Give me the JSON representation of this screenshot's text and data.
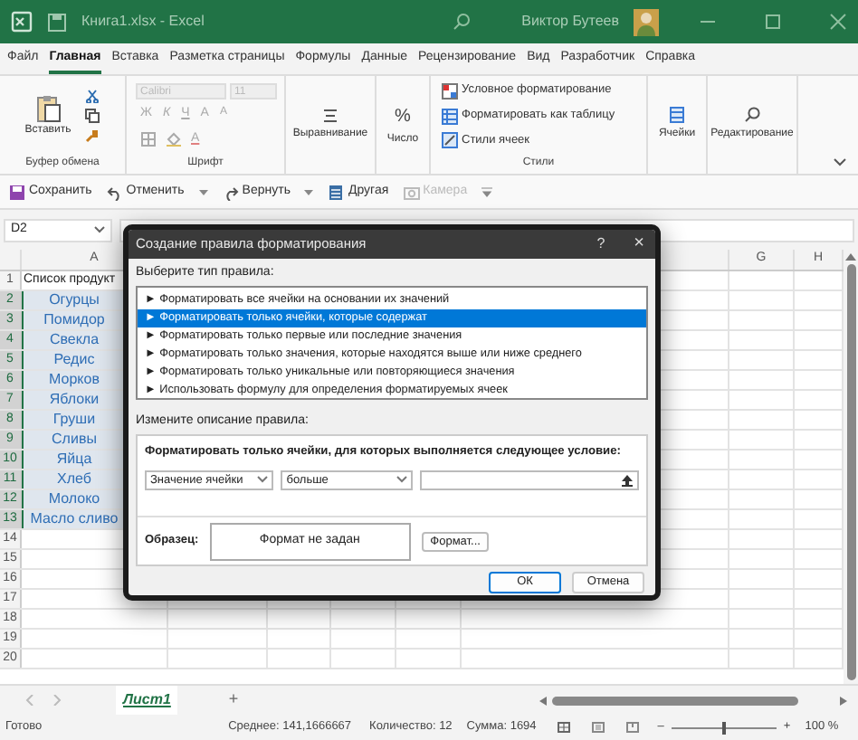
{
  "window": {
    "title": "Книга1.xlsx - Excel",
    "user": "Виктор Бутеев"
  },
  "ribbon_tabs": [
    {
      "label": "Файл",
      "selected": false
    },
    {
      "label": "Главная",
      "selected": true
    },
    {
      "label": "Вставка",
      "selected": false
    },
    {
      "label": "Разметка страницы",
      "selected": false
    },
    {
      "label": "Формулы",
      "selected": false
    },
    {
      "label": "Данные",
      "selected": false
    },
    {
      "label": "Рецензирование",
      "selected": false
    },
    {
      "label": "Вид",
      "selected": false
    },
    {
      "label": "Разработчик",
      "selected": false
    },
    {
      "label": "Справка",
      "selected": false
    }
  ],
  "ribbon": {
    "clipboard": {
      "paste": "Вставить",
      "label": "Буфер обмена"
    },
    "font": {
      "name": "Calibri",
      "size": "11",
      "bold": "Ж",
      "italic": "К",
      "underline": "Ч",
      "grow": "A",
      "shrink": "A",
      "font_color_button": "A",
      "label": "Шрифт"
    },
    "alignment": "Выравнивание",
    "number": {
      "symbol": "%",
      "label": "Число"
    },
    "styles": {
      "items": [
        "Условное форматирование",
        "Форматировать как таблицу",
        "Стили ячеек"
      ],
      "label": "Стили"
    },
    "cells": "Ячейки",
    "editing": "Редактирование"
  },
  "quick_access": [
    {
      "kind": "save",
      "label": "Сохранить",
      "disabled": false
    },
    {
      "kind": "undo",
      "label": "Отменить",
      "disabled": false
    },
    {
      "kind": "redo",
      "label": "Вернуть",
      "disabled": false
    },
    {
      "kind": "other",
      "label": "Другая",
      "disabled": false
    },
    {
      "kind": "camera",
      "label": "Камера",
      "disabled": true
    }
  ],
  "name_box": "D2",
  "sheet": {
    "columns": [
      {
        "label": "A"
      },
      {
        "label": "G"
      },
      {
        "label": "H"
      }
    ],
    "rows": [
      {
        "number": "1",
        "value": "Список продукт",
        "selected": false
      },
      {
        "number": "2",
        "value": "Огурцы",
        "selected": true
      },
      {
        "number": "3",
        "value": "Помидор",
        "selected": true
      },
      {
        "number": "4",
        "value": "Свекла",
        "selected": true
      },
      {
        "number": "5",
        "value": "Редис",
        "selected": true
      },
      {
        "number": "6",
        "value": "Морков",
        "selected": true
      },
      {
        "number": "7",
        "value": "Яблоки",
        "selected": true
      },
      {
        "number": "8",
        "value": "Груши",
        "selected": true
      },
      {
        "number": "9",
        "value": "Сливы",
        "selected": true
      },
      {
        "number": "10",
        "value": "Яйца",
        "selected": true
      },
      {
        "number": "11",
        "value": "Хлеб",
        "selected": true
      },
      {
        "number": "12",
        "value": "Молоко",
        "selected": true
      },
      {
        "number": "13",
        "value": "Масло сливо",
        "selected": true
      },
      {
        "number": "14",
        "selected": false
      },
      {
        "number": "15",
        "selected": false
      },
      {
        "number": "16",
        "selected": false
      },
      {
        "number": "17",
        "selected": false
      },
      {
        "number": "18",
        "selected": false
      },
      {
        "number": "19",
        "selected": false
      },
      {
        "number": "20",
        "selected": false
      }
    ]
  },
  "dialog": {
    "title": "Создание правила форматирования",
    "help": "?",
    "close": "×",
    "rule_type_label": "Выберите тип правила:",
    "rule_types": [
      {
        "label": "► Форматировать все ячейки на основании их значений",
        "selected": false
      },
      {
        "label": "► Форматировать только ячейки, которые содержат",
        "selected": true
      },
      {
        "label": "► Форматировать только первые или последние значения",
        "selected": false
      },
      {
        "label": "► Форматировать только значения, которые находятся выше или ниже среднего",
        "selected": false
      },
      {
        "label": "► Форматировать только уникальные или повторяющиеся значения",
        "selected": false
      },
      {
        "label": "► Использовать формулу для определения форматируемых ячеек",
        "selected": false
      }
    ],
    "description_label": "Измените описание правила:",
    "condition_title": "Форматировать только ячейки, для которых выполняется следующее условие:",
    "condition_field": "Значение ячейки",
    "operator": "больше",
    "preview_label": "Образец:",
    "preview": "Формат не задан",
    "format_button": "Формат...",
    "ok": "ОК",
    "cancel": "Отмена"
  },
  "sheet_tabs": [
    {
      "label": "Лист1",
      "selected": true
    }
  ],
  "add_sheet": "+",
  "status_bar": {
    "ready": "Готово",
    "average": "Среднее: 141,1666667",
    "count": "Количество: 12",
    "sum": "Сумма: 1694",
    "zoom_out": "–",
    "zoom_in": "+",
    "zoom": "100 %",
    "zoom_slider": {
      "level": 0.5
    }
  }
}
